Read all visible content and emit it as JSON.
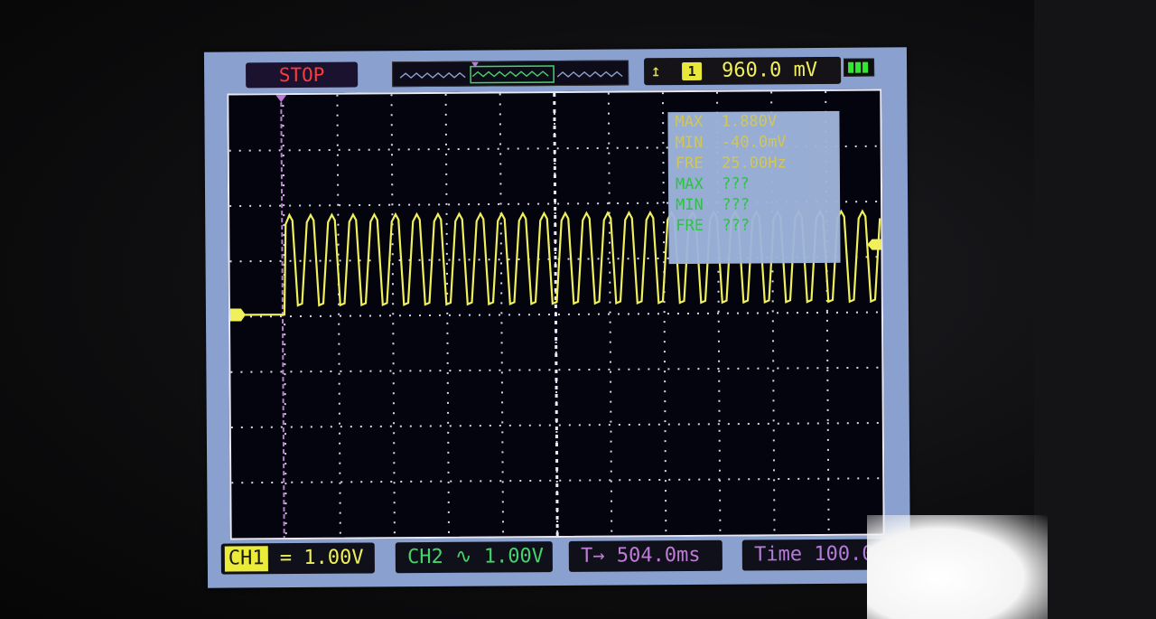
{
  "status": {
    "run_state": "STOP"
  },
  "trigger": {
    "edge_icon": "rising-edge-icon",
    "channel": "1",
    "level": "960.0 mV"
  },
  "battery": {
    "icon": "battery-icon",
    "bars": 3
  },
  "measurements": {
    "ch1": [
      {
        "label": "MAX",
        "value": "1.880V"
      },
      {
        "label": "MIN",
        "value": "-40.0mV"
      },
      {
        "label": "FRE",
        "value": "25.00Hz"
      }
    ],
    "ch2": [
      {
        "label": "MAX",
        "value": "???"
      },
      {
        "label": "MIN",
        "value": "???"
      },
      {
        "label": "FRE",
        "value": "???"
      }
    ]
  },
  "bottom": {
    "ch1_tag": "CH1",
    "ch1_coupling": "=",
    "ch1_scale": "1.00V",
    "ch2_label": "CH2",
    "ch2_coupling": "∿",
    "ch2_scale": "1.00V",
    "trigger_offset_label": "T→",
    "trigger_offset": "504.0ms",
    "time_label": "Time",
    "time_scale": "100.0ms"
  },
  "colors": {
    "ch1": "#f0f05a",
    "ch2": "#46d46a",
    "time": "#c07ad8",
    "stop": "#ff3a3a"
  }
}
